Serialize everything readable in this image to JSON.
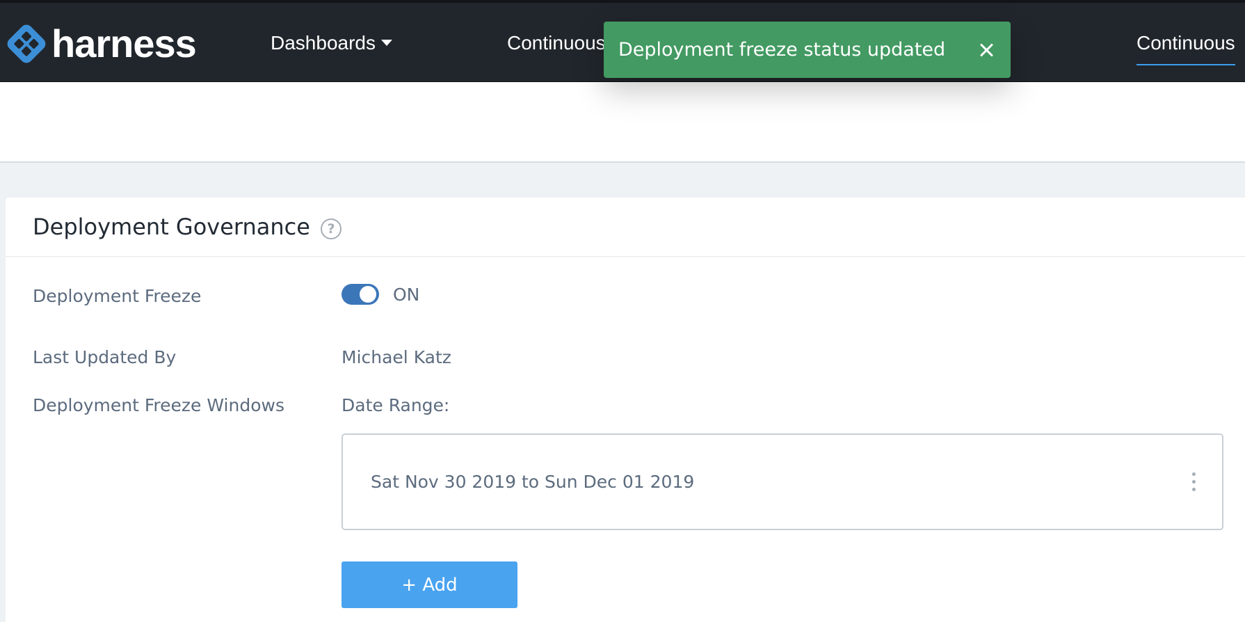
{
  "brand": {
    "name": "harness",
    "logo_icon": "harness-logo-icon"
  },
  "nav": {
    "dashboards": "Dashboards",
    "continuous_left": "Continuous",
    "continuous_right": "Continuous"
  },
  "toast": {
    "message": "Deployment freeze status updated",
    "close_icon": "close-icon",
    "color": "#439a62"
  },
  "panel": {
    "title": "Deployment Governance",
    "help_icon": "?",
    "freeze": {
      "label": "Deployment Freeze",
      "state": "ON",
      "enabled": true
    },
    "last_updated": {
      "label": "Last Updated By",
      "value": "Michael Katz"
    },
    "windows": {
      "label": "Deployment Freeze Windows",
      "date_range_label": "Date Range:",
      "items": [
        {
          "text": "Sat Nov 30 2019 to Sun Dec 01 2019"
        }
      ],
      "add_label": "+ Add"
    }
  },
  "colors": {
    "topbar": "#21262c",
    "accent": "#4aa3ef",
    "toggle": "#3b76b8"
  }
}
